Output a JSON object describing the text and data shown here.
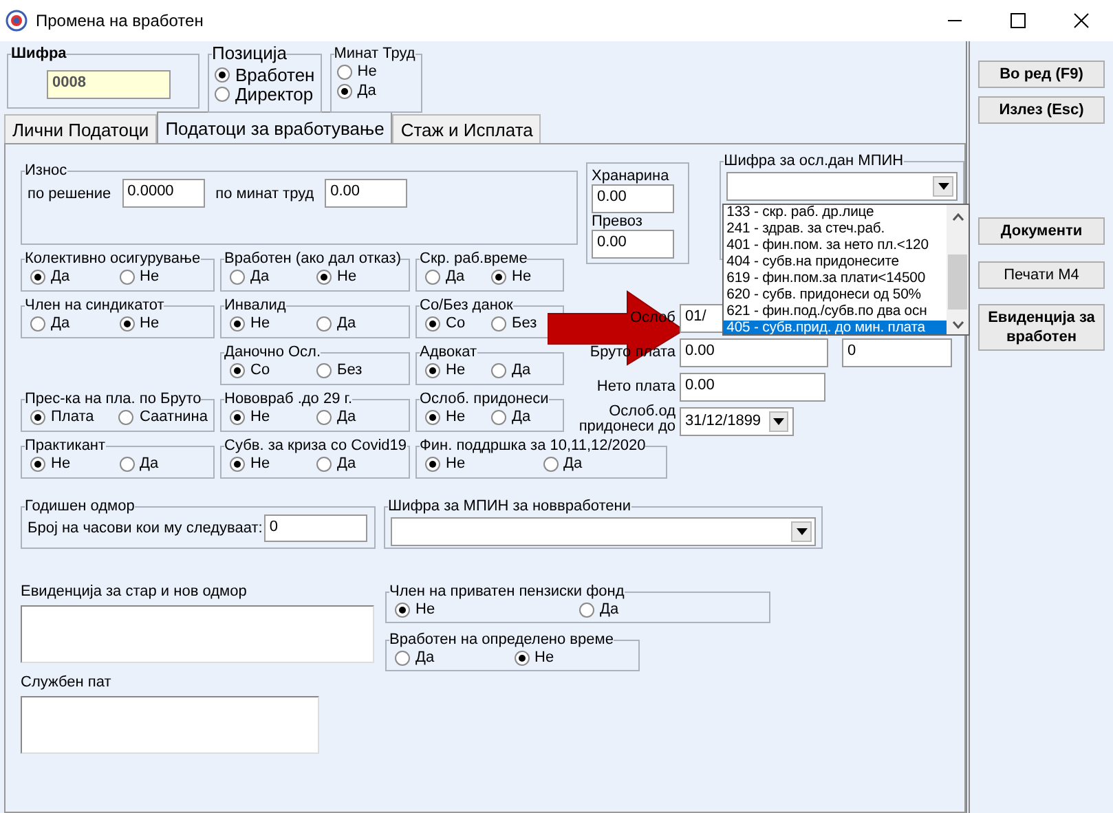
{
  "window": {
    "title": "Промена на вработен"
  },
  "code": {
    "label": "Шифра",
    "value": "0008"
  },
  "position": {
    "label": "Позиција",
    "options": [
      {
        "label": "Вработен",
        "selected": true
      },
      {
        "label": "Директор",
        "selected": false
      }
    ]
  },
  "past_work": {
    "label": "Минат Труд",
    "options": [
      {
        "label": "Не",
        "selected": false
      },
      {
        "label": "Да",
        "selected": true
      }
    ]
  },
  "tabs": [
    {
      "label": "Лични Податоци",
      "selected": false
    },
    {
      "label": "Податоци за вработување",
      "selected": true
    },
    {
      "label": "Стаж и Исплата",
      "selected": false
    }
  ],
  "amount": {
    "label": "Износ",
    "fields": [
      {
        "label": "по решение",
        "value": "0.0000"
      },
      {
        "label": "по минат труд",
        "value": "0.00"
      }
    ]
  },
  "radio_rows": [
    [
      {
        "label": "Колективно осигурување",
        "options": [
          {
            "label": "Да",
            "selected": true
          },
          {
            "label": "Не",
            "selected": false
          }
        ]
      },
      {
        "label": "Вработен (ако дал отказ)",
        "options": [
          {
            "label": "Да",
            "selected": false
          },
          {
            "label": "Не",
            "selected": true
          }
        ]
      },
      {
        "label": "Скр. раб.време",
        "options": [
          {
            "label": "Да",
            "selected": false
          },
          {
            "label": "Не",
            "selected": true
          }
        ]
      }
    ],
    [
      {
        "label": "Член на синдикатот",
        "options": [
          {
            "label": "Да",
            "selected": false
          },
          {
            "label": "Не",
            "selected": true
          }
        ]
      },
      {
        "label": "Инвалид",
        "options": [
          {
            "label": "Не",
            "selected": true
          },
          {
            "label": "Да",
            "selected": false
          }
        ]
      },
      {
        "label": "Со/Без данок",
        "options": [
          {
            "label": "Со",
            "selected": true
          },
          {
            "label": "Без",
            "selected": false
          }
        ]
      }
    ],
    [
      {
        "label": "Даночно Осл.",
        "options": [
          {
            "label": "Со",
            "selected": true
          },
          {
            "label": "Без",
            "selected": false
          }
        ]
      },
      {
        "label": "Адвокат",
        "options": [
          {
            "label": "Не",
            "selected": true
          },
          {
            "label": "Да",
            "selected": false
          }
        ]
      }
    ],
    [
      {
        "label": "Прес-ка на пла. по  Бруто",
        "options": [
          {
            "label": "Плата",
            "selected": true
          },
          {
            "label": "Саатнина",
            "selected": false
          }
        ]
      },
      {
        "label": "Нововраб .до 29 г.",
        "options": [
          {
            "label": "Не",
            "selected": true
          },
          {
            "label": "Да",
            "selected": false
          }
        ]
      },
      {
        "label": "Ослоб. придонеси",
        "options": [
          {
            "label": "Не",
            "selected": true
          },
          {
            "label": "Да",
            "selected": false
          }
        ]
      }
    ],
    [
      {
        "label": "Практикант",
        "options": [
          {
            "label": "Не",
            "selected": true
          },
          {
            "label": "Да",
            "selected": false
          }
        ]
      },
      {
        "label": "Субв. за криза со Covid19",
        "options": [
          {
            "label": "Не",
            "selected": true
          },
          {
            "label": "Да",
            "selected": false
          }
        ]
      },
      {
        "label": "Фин. поддршка за 10,11,12/2020",
        "options": [
          {
            "label": "Не",
            "selected": true
          },
          {
            "label": "Да",
            "selected": false
          }
        ]
      }
    ]
  ],
  "allowances": [
    {
      "label": "Хранарина",
      "value": "0.00"
    },
    {
      "label": "Превоз",
      "value": "0.00"
    }
  ],
  "mpin": {
    "label": "Шифра за осл.дан МПИН",
    "options": [
      {
        "label": "133 - скр. раб. др.лице",
        "selected": false
      },
      {
        "label": "241 - здрав. за стеч.раб.",
        "selected": false
      },
      {
        "label": "401 - фин.пом. за нето пл.<120",
        "selected": false
      },
      {
        "label": "404 - субв.на придонесите",
        "selected": false
      },
      {
        "label": "619 - фин.пом.за плати<14500",
        "selected": false
      },
      {
        "label": "620 - субв. придонеси од 50%",
        "selected": false
      },
      {
        "label": "621 - фин.под./субв.по два осн",
        "selected": false
      },
      {
        "label": "405 - субв.прид. до мин. плата",
        "selected": true
      }
    ]
  },
  "relief": {
    "label": "Ослоб",
    "value": "01/"
  },
  "gross": {
    "label": "Бруто плата",
    "value": "0.00",
    "extra": "0"
  },
  "net": {
    "label": "Нето плата",
    "value": "0.00"
  },
  "relief_until": {
    "label": "Ослоб.од придонеси до",
    "value": "31/12/1899"
  },
  "buttons": [
    {
      "label": "Во ред (F9)",
      "bold": true
    },
    {
      "label": "Излез (Esc)",
      "bold": true
    },
    {
      "label": "Документи",
      "bold": true
    },
    {
      "label": "Печати М4",
      "bold": false
    },
    {
      "label": "Евиденција за вработен",
      "bold": true
    }
  ],
  "annual_leave": {
    "label": "Годишен одмор",
    "field_label": "Број на часови кои му следуваат:",
    "value": "0"
  },
  "new_mpin": {
    "label": "Шифра за МПИН за новвработени"
  },
  "notes": [
    {
      "label": "Евиденција за стар и нов одмор"
    },
    {
      "label": "Службен пат"
    }
  ],
  "bottom_groups": [
    {
      "label": "Член на приватен пензиски фонд",
      "options": [
        {
          "label": "Не",
          "selected": true
        },
        {
          "label": "Да",
          "selected": false
        }
      ]
    },
    {
      "label": "Вработен на определено време",
      "options": [
        {
          "label": "Да",
          "selected": false
        },
        {
          "label": "Не",
          "selected": true
        }
      ]
    }
  ]
}
